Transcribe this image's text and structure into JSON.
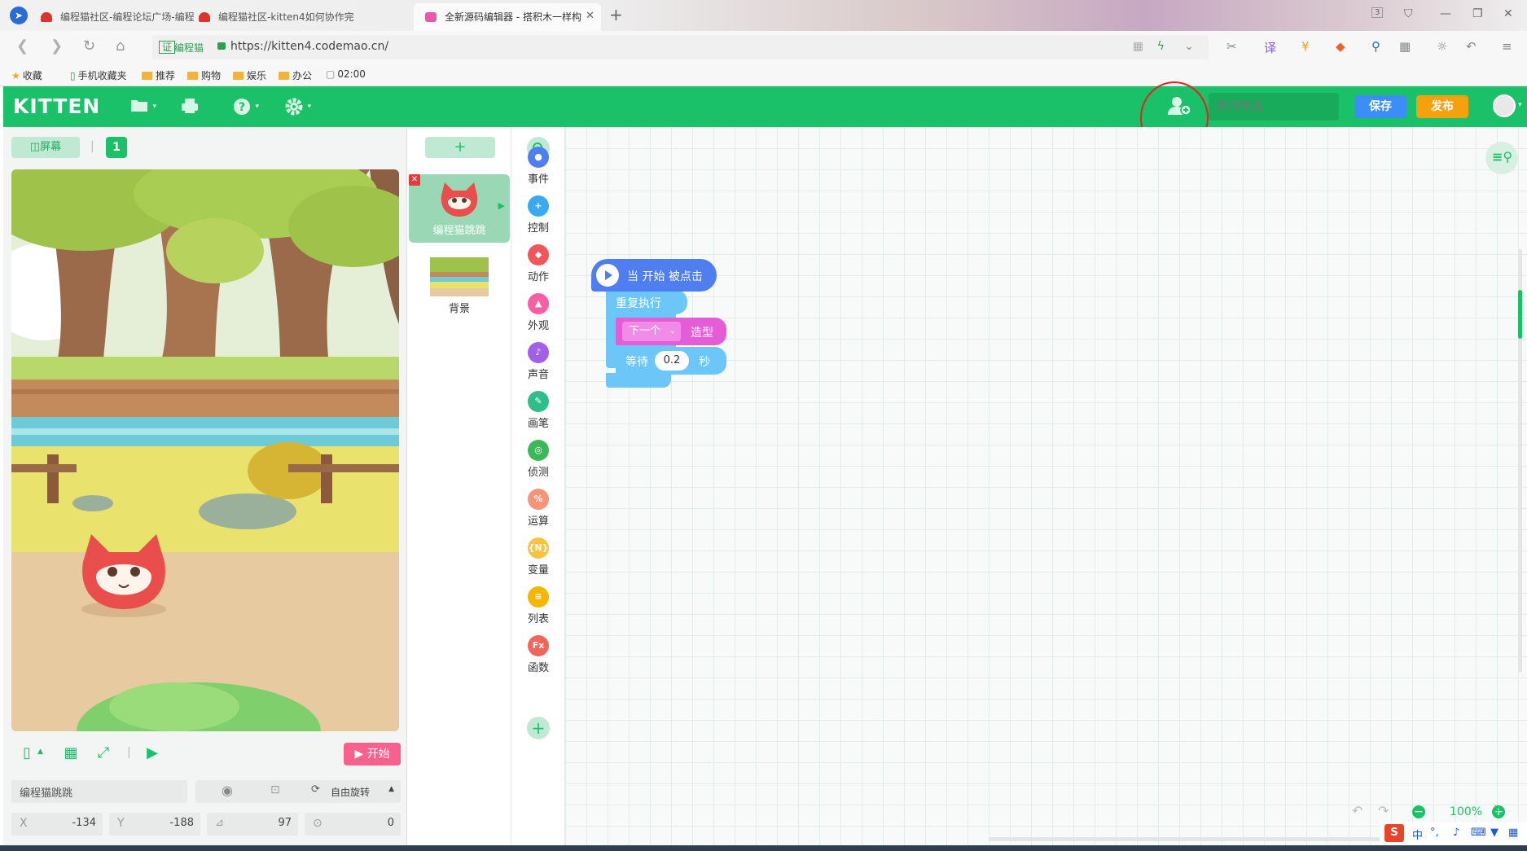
{
  "browser": {
    "tabs": [
      {
        "title": "编程猫社区-编程论坛广场-编程",
        "active": false
      },
      {
        "title": "编程猫社区-kitten4如何协作完",
        "active": false
      },
      {
        "title": "全新源码编辑器 - 搭积木一样构",
        "active": true
      }
    ],
    "window_badge": "3",
    "address": {
      "badge": "证",
      "site_name": "编程猫",
      "url": "https://kitten4.codemao.cn/"
    },
    "bookmarks": [
      {
        "label": "收藏",
        "icon": "star-icon"
      },
      {
        "label": "手机收藏夹",
        "icon": "phone-icon"
      },
      {
        "label": "推荐",
        "icon": "folder-icon"
      },
      {
        "label": "购物",
        "icon": "folder-icon"
      },
      {
        "label": "娱乐",
        "icon": "folder-icon"
      },
      {
        "label": "办公",
        "icon": "folder-icon"
      },
      {
        "label": "02:00",
        "icon": "page-icon"
      }
    ]
  },
  "app": {
    "logo": "KITTEN",
    "work_name_placeholder": "新的作品",
    "save_label": "保存",
    "publish_label": "发布",
    "colors": {
      "brand": "#1bc168",
      "save": "#3a8ef6",
      "publish": "#f5a10d",
      "start": "#f8608e"
    }
  },
  "stage": {
    "screen_label": "屏幕",
    "screen_number": "1",
    "start_label": "开始",
    "sprite_name": "编程猫跳跳",
    "rotation_label": "自由旋转",
    "props": {
      "x_label": "X",
      "x": "-134",
      "y_label": "Y",
      "y": "-188",
      "size": "97",
      "direction": "0"
    }
  },
  "sprites": [
    {
      "name": "编程猫跳跳",
      "selected": true
    },
    {
      "name": "背景",
      "selected": false
    }
  ],
  "categories": [
    {
      "label": "事件",
      "color": "#4f7ef0",
      "icon": "event-icon",
      "glyph": "●"
    },
    {
      "label": "控制",
      "color": "#39a9f2",
      "icon": "control-icon",
      "glyph": "+"
    },
    {
      "label": "动作",
      "color": "#f0575a",
      "icon": "motion-icon",
      "glyph": "◆"
    },
    {
      "label": "外观",
      "color": "#f75fa2",
      "icon": "looks-icon",
      "glyph": "▲"
    },
    {
      "label": "声音",
      "color": "#a061e8",
      "icon": "sound-icon",
      "glyph": "♪"
    },
    {
      "label": "画笔",
      "color": "#2dbe8a",
      "icon": "pen-icon",
      "glyph": "✎"
    },
    {
      "label": "侦测",
      "color": "#3cb85a",
      "icon": "sensing-icon",
      "glyph": "◎"
    },
    {
      "label": "运算",
      "color": "#f59477",
      "icon": "operator-icon",
      "glyph": "%"
    },
    {
      "label": "变量",
      "color": "#f7c342",
      "icon": "variable-icon",
      "glyph": "{N}"
    },
    {
      "label": "列表",
      "color": "#f5b500",
      "icon": "list-icon",
      "glyph": "≡"
    },
    {
      "label": "函数",
      "color": "#f3645a",
      "icon": "function-icon",
      "glyph": "Fx"
    }
  ],
  "blocks": {
    "hat": "当 开始 被点击",
    "repeat": "重复执行",
    "costume_option": "下一个",
    "costume_label": "造型",
    "wait_label": "等待",
    "wait_value": "0.2",
    "wait_unit": "秒"
  },
  "workspace": {
    "zoom": "100%"
  },
  "ime": {
    "lang": "中"
  }
}
